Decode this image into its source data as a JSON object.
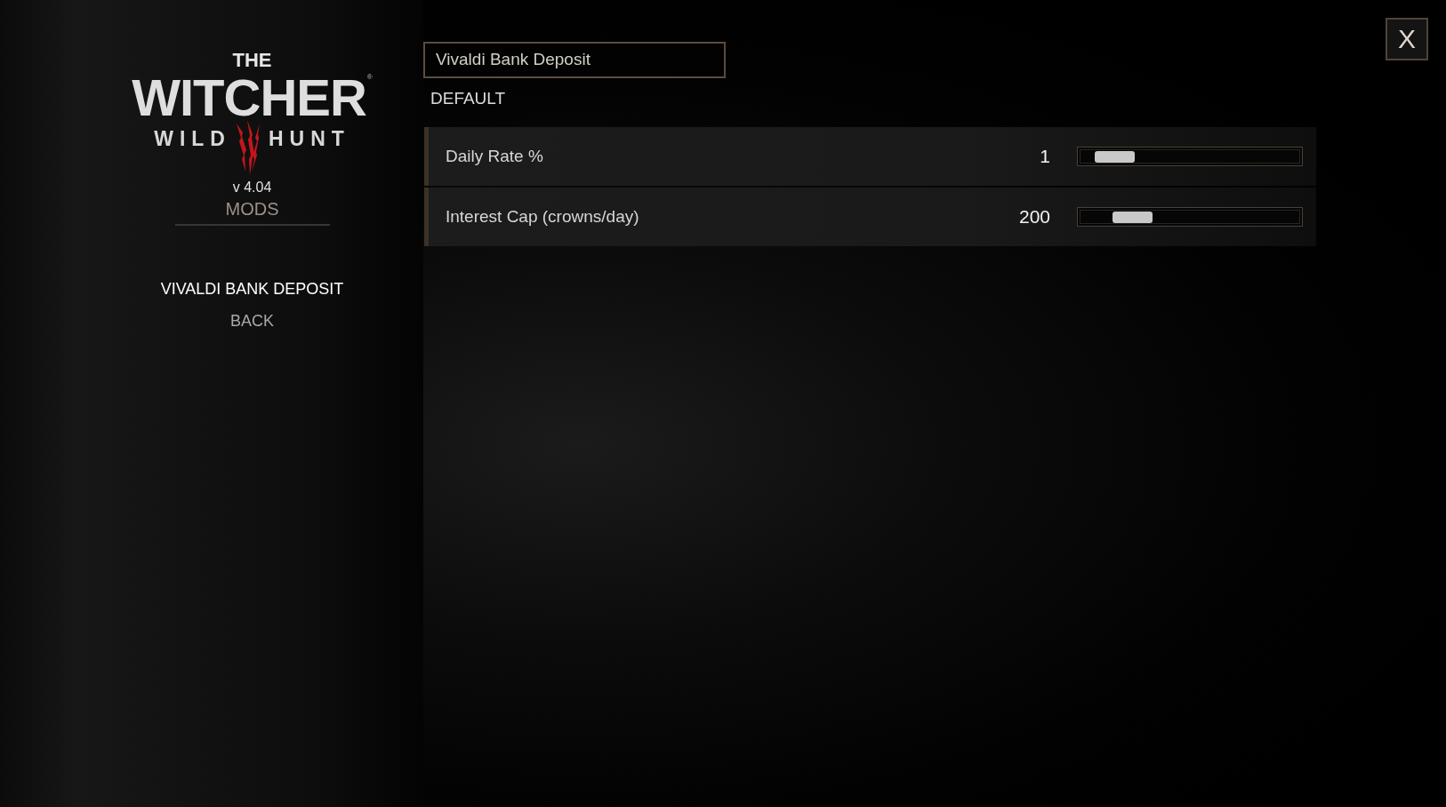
{
  "logo": {
    "top": "THE",
    "title": "WITCHER",
    "registered_mark": "®",
    "subtitle_left": "WILD",
    "subtitle_right": "HUNT"
  },
  "version": "v 4.04",
  "section_title": "MODS",
  "menu": [
    {
      "label": "VIVALDI BANK DEPOSIT",
      "selected": true
    },
    {
      "label": "BACK",
      "selected": false
    }
  ],
  "panel": {
    "title": "Vivaldi Bank Deposit",
    "default_button": "DEFAULT",
    "options": [
      {
        "label": "Daily Rate %",
        "value": "1",
        "level": 0.08
      },
      {
        "label": "Interest Cap (crowns/day)",
        "value": "200",
        "level": 0.18
      }
    ]
  },
  "close_button": {
    "label": "X"
  }
}
